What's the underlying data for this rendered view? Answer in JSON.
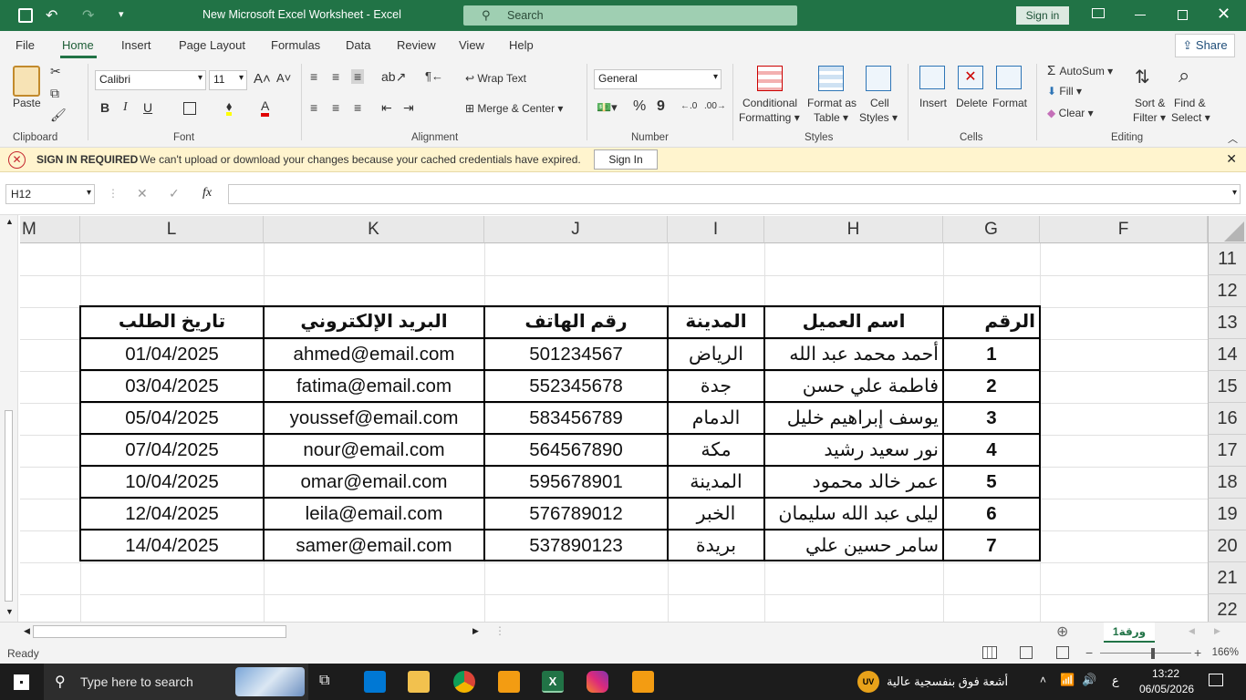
{
  "window": {
    "title": "New Microsoft Excel Worksheet  -  Excel",
    "search_placeholder": "Search",
    "sign_in": "Sign in",
    "share": "Share"
  },
  "menu": {
    "tabs": [
      "File",
      "Home",
      "Insert",
      "Page Layout",
      "Formulas",
      "Data",
      "Review",
      "View",
      "Help"
    ]
  },
  "ribbon": {
    "clipboard": {
      "paste": "Paste",
      "group": "Clipboard"
    },
    "font": {
      "name": "Calibri",
      "size": "11",
      "bold": "B",
      "italic": "I",
      "underline": "U",
      "group": "Font"
    },
    "alignment": {
      "wrap_text": "Wrap Text",
      "merge_center": "Merge & Center",
      "group": "Alignment"
    },
    "number": {
      "format": "General",
      "percent": "%",
      "comma": "9",
      "group": "Number"
    },
    "styles": {
      "conditional": "Conditional",
      "formatting": "Formatting",
      "format_as": "Format as",
      "table": "Table",
      "cell": "Cell",
      "styles_label": "Styles",
      "group": "Styles"
    },
    "cells": {
      "insert": "Insert",
      "delete": "Delete",
      "format": "Format",
      "group": "Cells"
    },
    "editing": {
      "autosum": "AutoSum",
      "fill": "Fill",
      "clear": "Clear",
      "sort": "Sort &",
      "filter": "Filter",
      "find": "Find &",
      "select": "Select",
      "group": "Editing"
    }
  },
  "message_bar": {
    "title": "SIGN IN REQUIRED",
    "text": "We can't upload or download your changes because your cached credentials have expired.",
    "button": "Sign In"
  },
  "formula_bar": {
    "name_box": "H12",
    "fx": "fx",
    "content": ""
  },
  "columns": [
    "M",
    "L",
    "K",
    "J",
    "I",
    "H",
    "G",
    "F"
  ],
  "rows": [
    "11",
    "12",
    "13",
    "14",
    "15",
    "16",
    "17",
    "18",
    "19",
    "20",
    "21",
    "22"
  ],
  "table": {
    "headers": {
      "number": "الرقم",
      "name": "اسم العميل",
      "city": "المدينة",
      "phone": "رقم الهاتف",
      "email": "البريد الإلكتروني",
      "date": "تاريخ الطلب"
    },
    "records": [
      {
        "number": "1",
        "name": "أحمد محمد عبد الله",
        "city": "الرياض",
        "phone": "501234567",
        "email": "ahmed@email.com",
        "date": "01/04/2025"
      },
      {
        "number": "2",
        "name": "فاطمة علي حسن",
        "city": "جدة",
        "phone": "552345678",
        "email": "fatima@email.com",
        "date": "03/04/2025"
      },
      {
        "number": "3",
        "name": "يوسف إبراهيم خليل",
        "city": "الدمام",
        "phone": "583456789",
        "email": "youssef@email.com",
        "date": "05/04/2025"
      },
      {
        "number": "4",
        "name": "نور سعيد رشيد",
        "city": "مكة",
        "phone": "564567890",
        "email": "nour@email.com",
        "date": "07/04/2025"
      },
      {
        "number": "5",
        "name": "عمر خالد محمود",
        "city": "المدينة",
        "phone": "595678901",
        "email": "omar@email.com",
        "date": "10/04/2025"
      },
      {
        "number": "6",
        "name": "ليلى عبد الله سليمان",
        "city": "الخبر",
        "phone": "576789012",
        "email": "leila@email.com",
        "date": "12/04/2025"
      },
      {
        "number": "7",
        "name": "سامر حسين علي",
        "city": "بريدة",
        "phone": "537890123",
        "email": "samer@email.com",
        "date": "14/04/2025"
      }
    ]
  },
  "sheet_tab": "ورقة1",
  "status": {
    "ready": "Ready",
    "zoom": "166%"
  },
  "taskbar": {
    "search_placeholder": "Type here to search",
    "weather": "أشعة فوق بنفسجية عالية",
    "time": "13:22",
    "date": "06/05/2026",
    "lang": "ع"
  }
}
